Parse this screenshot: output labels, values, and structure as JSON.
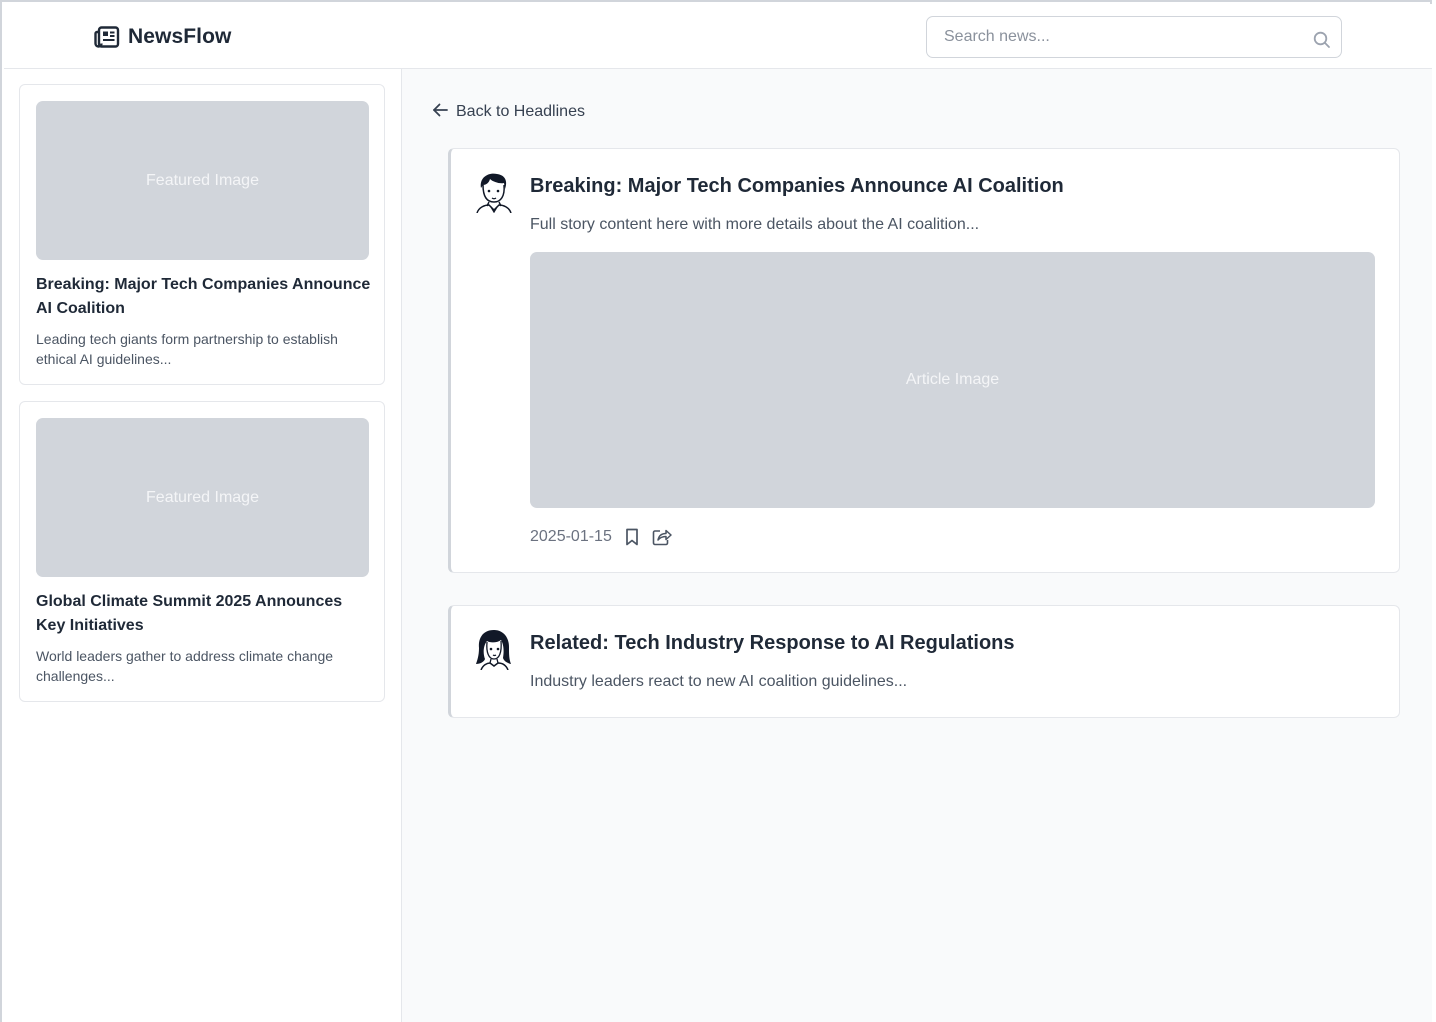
{
  "header": {
    "brand_name": "NewsFlow",
    "brand_icon": "newspaper-icon",
    "search": {
      "placeholder": "Search news...",
      "value": "",
      "icon": "search-icon"
    }
  },
  "sidebar": {
    "cards": [
      {
        "image_label": "Featured Image",
        "title": "Breaking: Major Tech Companies Announce AI Coalition",
        "excerpt": "Leading tech giants form partnership to establish ethical AI guidelines..."
      },
      {
        "image_label": "Featured Image",
        "title": "Global Climate Summit 2025 Announces Key Initiatives",
        "excerpt": "World leaders gather to address climate change challenges..."
      }
    ]
  },
  "main": {
    "back_label": "Back to Headlines",
    "article": {
      "title": "Breaking: Major Tech Companies Announce AI Coalition",
      "body": "Full story content here with more details about the AI coalition...",
      "image_label": "Article Image",
      "date": "2025-01-15",
      "actions": [
        "bookmark-icon",
        "share-icon"
      ]
    },
    "related": {
      "title": "Related: Tech Industry Response to AI Regulations",
      "body": "Industry leaders react to new AI coalition guidelines..."
    }
  },
  "colors": {
    "placeholder_gray": "#d1d5db",
    "text_dark": "#1f2937",
    "text_muted": "#4b5563",
    "border": "#e5e7eb",
    "main_bg": "#f9fafb"
  }
}
